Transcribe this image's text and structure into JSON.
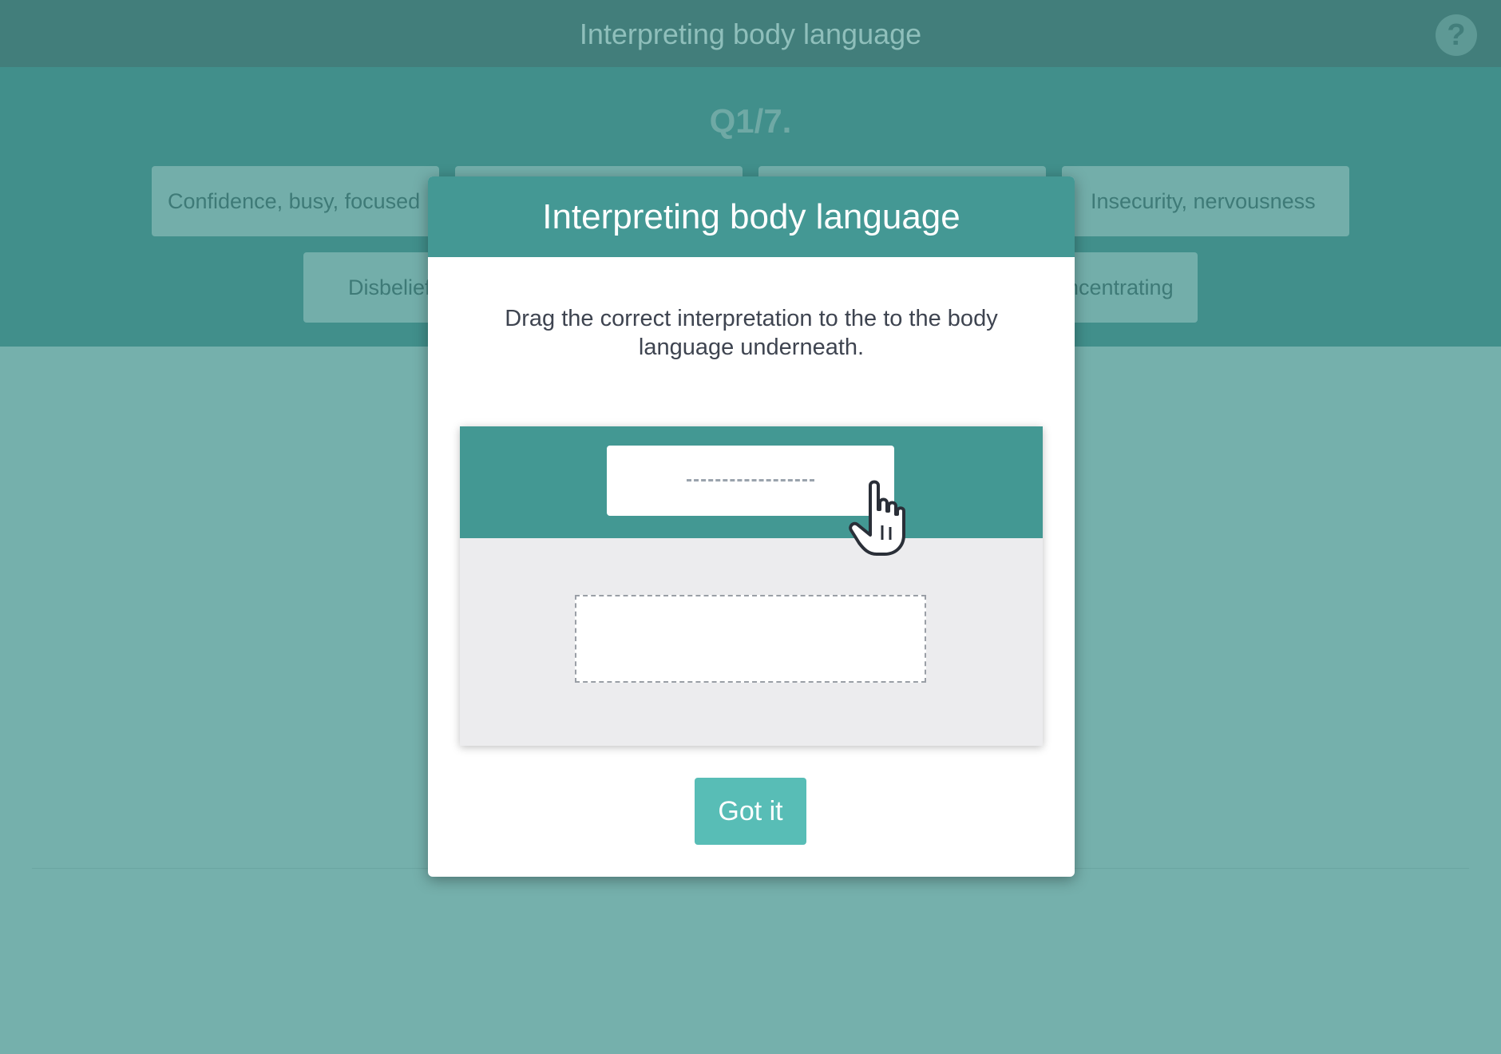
{
  "header": {
    "title": "Interpreting body language",
    "help_icon": "question-circle-icon"
  },
  "question": {
    "counter": "Q1/7."
  },
  "options": [
    {
      "label": "Confidence, busy, focused"
    },
    {
      "label": ""
    },
    {
      "label": ""
    },
    {
      "label": "Insecurity, nervousness"
    },
    {
      "label": "Disbelief"
    },
    {
      "label": "ncentrating"
    }
  ],
  "modal": {
    "title": "Interpreting body language",
    "instruction": "Drag the correct interpretation to the to the body language underneath.",
    "button_label": "Got it",
    "illustration_icon": "pointing-hand-cursor-icon"
  },
  "colors": {
    "header_bg": "#427e7b",
    "band_bg": "#418f8b",
    "page_bg": "#75b0ac",
    "modal_header_bg": "#449894",
    "button_bg": "#58bdb6"
  }
}
